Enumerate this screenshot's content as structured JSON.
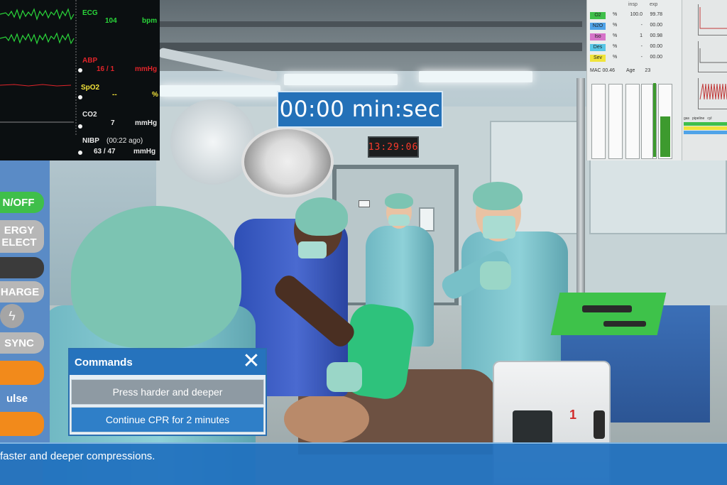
{
  "timer": {
    "text": "00:00 min:sec"
  },
  "wall_clock": {
    "text": "13:29:06"
  },
  "monitor": {
    "ecg": {
      "label": "ECG",
      "value": "104",
      "unit": "bpm",
      "color": "#2ad63a"
    },
    "abp": {
      "label": "ABP",
      "value": "16 / 1",
      "unit": "mmHg",
      "color": "#e0242a"
    },
    "spo2": {
      "label": "SpO2",
      "value": "--",
      "unit": "%",
      "color": "#f4e43a"
    },
    "co2": {
      "label": "CO2",
      "value": "7",
      "unit": "mmHg",
      "color": "#e8e8e8"
    },
    "nibp": {
      "label": "NIBP",
      "ago": "(00:22 ago)",
      "value": "63 / 47",
      "unit": "mmHg",
      "color": "#e8e8e8"
    }
  },
  "gas_panel": {
    "headers": {
      "insp": "insp",
      "exp": "exp"
    },
    "rows": [
      {
        "name": "O2",
        "unit": "%",
        "insp": "100.0",
        "exp": "99.78",
        "color": "#3fbf4a"
      },
      {
        "name": "N2O",
        "unit": "%",
        "insp": "-",
        "exp": "00.00",
        "color": "#4fa3e8"
      },
      {
        "name": "Iso",
        "unit": "%",
        "insp": "1",
        "exp": "00.98",
        "color": "#d673c9"
      },
      {
        "name": "Des",
        "unit": "%",
        "insp": "-",
        "exp": "00.00",
        "color": "#57c6e6"
      },
      {
        "name": "Sev",
        "unit": "%",
        "insp": "-",
        "exp": "00.00",
        "color": "#f0e43a"
      }
    ],
    "mac": {
      "label": "MAC",
      "value": "00.46",
      "age_label": "Age",
      "age_value": "23"
    }
  },
  "side_panel": {
    "pipe_headers": [
      "gas",
      "pipeline",
      "cyl"
    ]
  },
  "defib_controls": {
    "on_off": "N/OFF",
    "energy_select": "ERGY\nELECT",
    "charge": "HARGE",
    "sync": "SYNC",
    "pulse": "ulse"
  },
  "commands": {
    "title": "Commands",
    "close": "✕",
    "options": [
      "Press harder and deeper",
      "Continue CPR for 2 minutes"
    ]
  },
  "subtitle": {
    "text": "faster and deeper compressions."
  },
  "defibrillator": {
    "number": "1"
  }
}
